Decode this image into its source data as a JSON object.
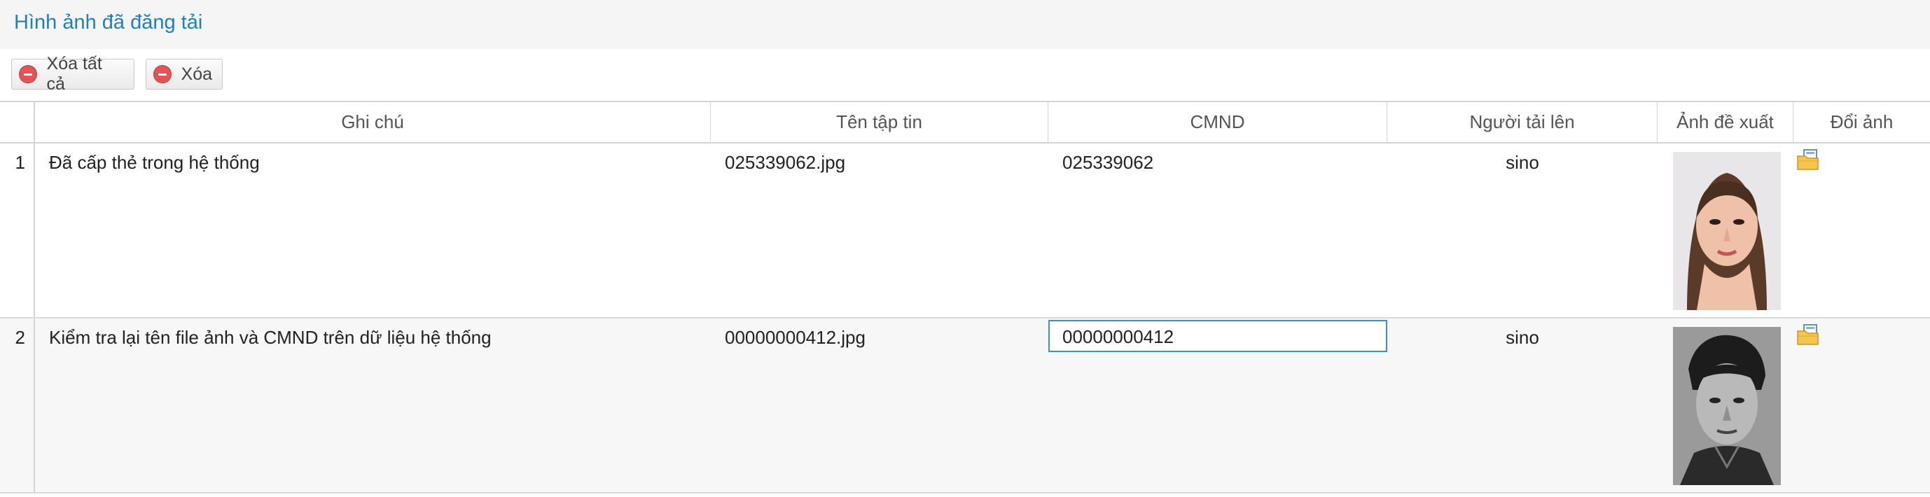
{
  "panel": {
    "title": "Hình ảnh đã đăng tải"
  },
  "toolbar": {
    "delete_all_label": "Xóa tất cả",
    "delete_label": "Xóa"
  },
  "table": {
    "columns": [
      "Ghi chú",
      "Tên tập tin",
      "CMND",
      "Người tải lên",
      "Ảnh đề xuất",
      "Đổi ảnh"
    ],
    "rows": [
      {
        "index": "1",
        "note": "Đã cấp thẻ trong hệ thống",
        "filename": "025339062.jpg",
        "cmnd": "025339062",
        "uploader": "sino"
      },
      {
        "index": "2",
        "note": "Kiểm tra lại tên file ảnh và CMND trên dữ liệu hệ thống",
        "filename": "00000000412.jpg",
        "cmnd": "00000000412",
        "uploader": "sino"
      }
    ]
  },
  "icons": {
    "remove": "remove-circle-icon",
    "change_image": "folder-image-icon"
  },
  "colors": {
    "title": "#1f7fc7",
    "active_border": "#3b8fd4",
    "remove_icon": "#e05555"
  }
}
